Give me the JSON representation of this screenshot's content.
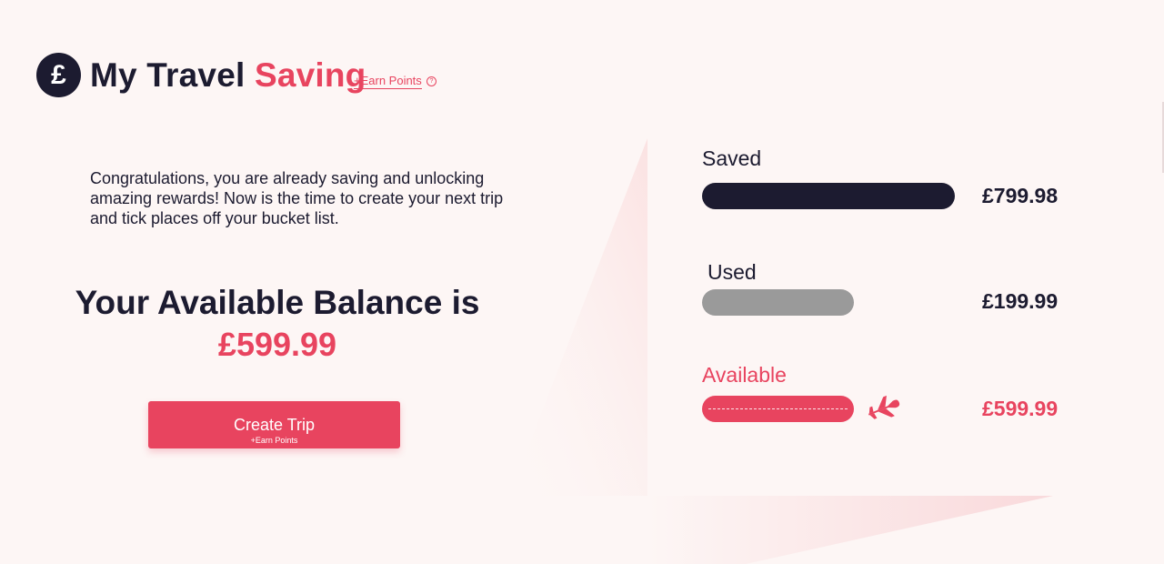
{
  "header": {
    "logo_symbol": "£",
    "brand_part1": "My Travel",
    "brand_part2": "Saving",
    "earn_link": "+Earn Points",
    "help_symbol": "?"
  },
  "intro_text": "Congratulations, you are already saving and unlocking amazing rewards! Now is the time to create your next trip and tick places off your bucket list.",
  "balance": {
    "title": "Your Available Balance is",
    "amount": "£599.99"
  },
  "create_button": {
    "label": "Create Trip",
    "sublabel": "+Earn Points"
  },
  "breakdown": {
    "saved": {
      "label": "Saved",
      "amount": "£799.98",
      "level": 1.0
    },
    "used": {
      "label": "Used",
      "amount": "£199.99",
      "level": 0.6
    },
    "available": {
      "label": "Available",
      "amount": "£599.99",
      "level": 0.6,
      "icon": "airplane-icon"
    }
  },
  "colors": {
    "accent": "#e8445f",
    "navy": "#1c1b30",
    "used_grey": "#9a9a9a",
    "background": "#fdf6f5"
  }
}
